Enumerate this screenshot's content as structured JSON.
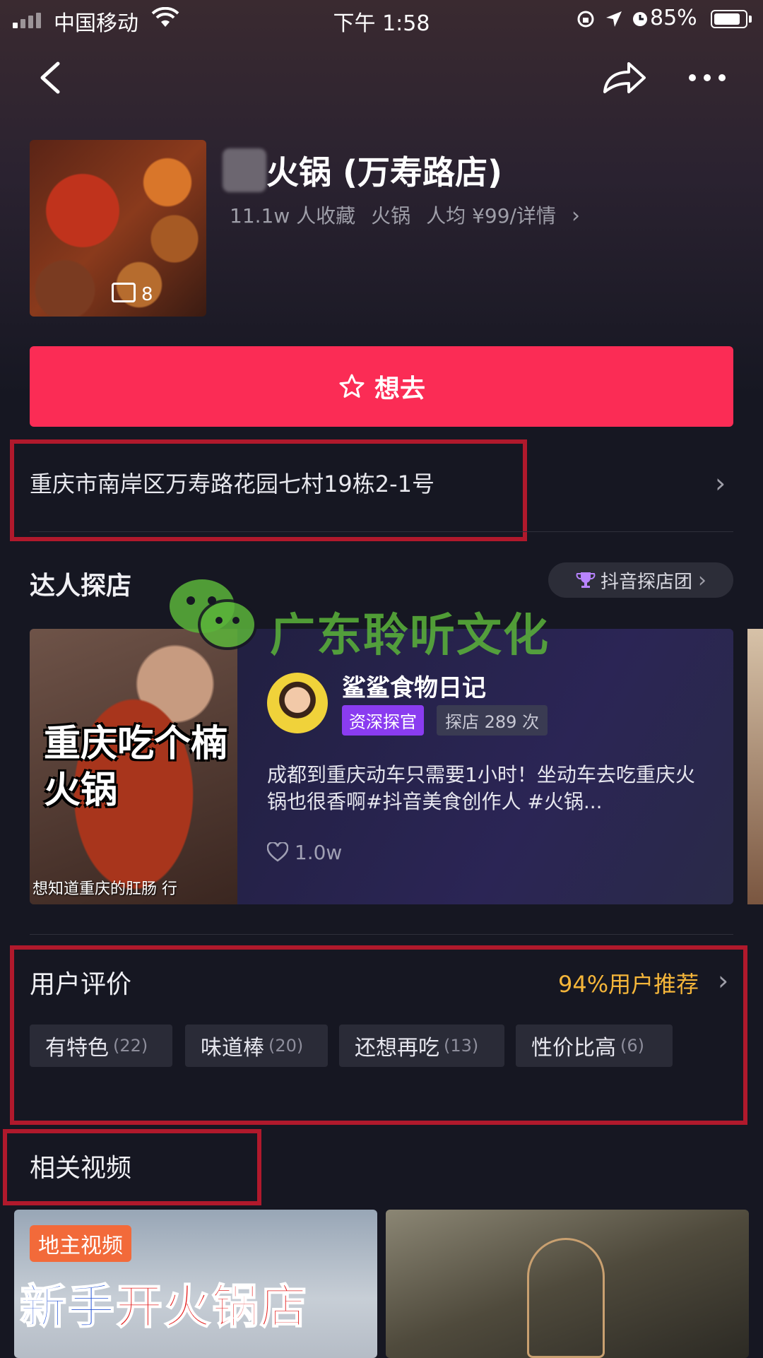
{
  "status_bar": {
    "carrier": "中国移动",
    "time": "下午 1:58",
    "battery": "85%"
  },
  "shop": {
    "name": "火锅 (万寿路店)",
    "photo_count": "8",
    "meta": {
      "favorites": "11.1w 人收藏",
      "category": "火锅",
      "avg_price": "人均 ¥99/详情"
    },
    "want_button": "想去",
    "address": "重庆市南岸区万寿路花园七村19栋2-1号"
  },
  "influencers": {
    "title": "达人探店",
    "team_link": "抖音探店团",
    "card": {
      "image_title": "重庆吃个楠火锅",
      "image_caption": "想知道重庆的肛肠 行",
      "author": "鲨鲨食物日记",
      "badge": "资深探官",
      "visits": "探店 289 次",
      "description": "成都到重庆动车只需要1小时！坐动车去吃重庆火锅也很香啊#抖音美食创作人 #火锅...",
      "likes": "1.0w"
    }
  },
  "watermark": "广东聆听文化",
  "reviews": {
    "title": "用户评价",
    "recommend": "94%用户推荐",
    "tags": [
      {
        "label": "有特色",
        "count": "(22)"
      },
      {
        "label": "味道棒",
        "count": "(20)"
      },
      {
        "label": "还想再吃",
        "count": "(13)"
      },
      {
        "label": "性价比高",
        "count": "(6)"
      }
    ]
  },
  "related": {
    "title": "相关视频",
    "video1": {
      "tag": "地主视频",
      "title_a": "新手",
      "title_b": "开火锅店"
    }
  },
  "colors": {
    "accent": "#fb2c55",
    "recommend": "#f5b63a",
    "highlight_box": "#b0192c"
  }
}
